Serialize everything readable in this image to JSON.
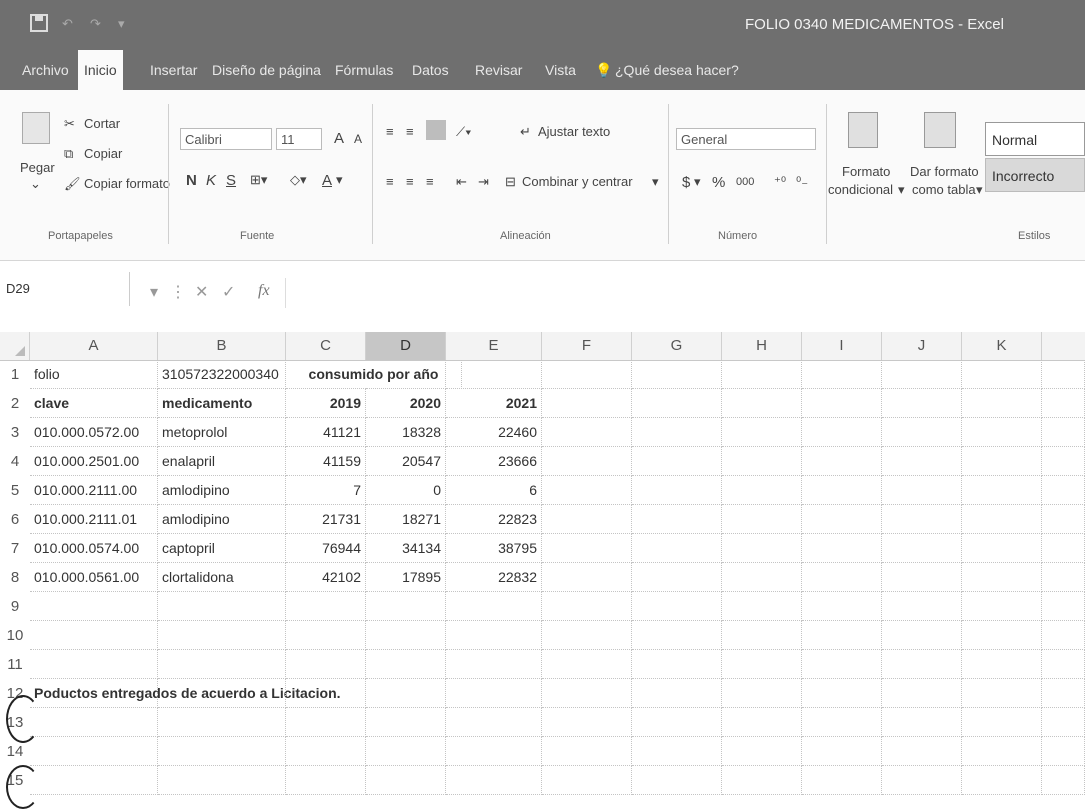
{
  "app": {
    "window_title": "FOLIO 0340 MEDICAMENTOS - Excel"
  },
  "tabs": [
    "Archivo",
    "Inicio",
    "Insertar",
    "Diseño de página",
    "Fórmulas",
    "Datos",
    "Revisar",
    "Vista"
  ],
  "tell_me": "¿Qué desea hacer?",
  "ribbon": {
    "clipboard": {
      "paste": "Pegar",
      "cut": "Cortar",
      "copy": "Copiar",
      "format_painter": "Copiar formato",
      "group": "Portapapeles"
    },
    "font": {
      "name": "Calibri",
      "size": "11",
      "bold": "N",
      "italic": "K",
      "underline": "S",
      "grow": "A",
      "shrink": "A",
      "group": "Fuente"
    },
    "alignment": {
      "wrap_text": "Ajustar texto",
      "merge_center": "Combinar y centrar",
      "group": "Alineación"
    },
    "number": {
      "format": "General",
      "currency": "$",
      "percent": "%",
      "thousands": "000",
      "group": "Número"
    },
    "styles": {
      "conditional_line1": "Formato",
      "conditional_line2": "condicional",
      "as_table_line1": "Dar formato",
      "as_table_line2": "como tabla",
      "normal": "Normal",
      "bad": "Incorrecto",
      "group": "Estilos"
    }
  },
  "formula_bar": {
    "name_box": "D29",
    "fx": "fx",
    "content": ""
  },
  "columns": [
    "A",
    "B",
    "C",
    "D",
    "E",
    "F",
    "G",
    "H",
    "I",
    "J",
    "K"
  ],
  "selected_column": "D",
  "rows": [
    {
      "n": "1",
      "cells": {
        "A": "folio",
        "B": "310572322000340",
        "C": "consumido por año"
      }
    },
    {
      "n": "2",
      "cells": {
        "A": "clave",
        "B": "medicamento",
        "C": "2019",
        "D": "2020",
        "E": "2021"
      }
    },
    {
      "n": "3",
      "cells": {
        "A": "010.000.0572.00",
        "B": "metoprolol",
        "C": "41121",
        "D": "18328",
        "E": "22460"
      }
    },
    {
      "n": "4",
      "cells": {
        "A": "010.000.2501.00",
        "B": "enalapril",
        "C": "41159",
        "D": "20547",
        "E": "23666"
      }
    },
    {
      "n": "5",
      "cells": {
        "A": "010.000.2111.00",
        "B": "amlodipino",
        "C": "7",
        "D": "0",
        "E": "6"
      }
    },
    {
      "n": "6",
      "cells": {
        "A": "010.000.2111.01",
        "B": "amlodipino",
        "C": "21731",
        "D": "18271",
        "E": "22823"
      }
    },
    {
      "n": "7",
      "cells": {
        "A": "010.000.0574.00",
        "B": "captopril",
        "C": "76944",
        "D": "34134",
        "E": "38795"
      }
    },
    {
      "n": "8",
      "cells": {
        "A": "010.000.0561.00",
        "B": "clortalidona",
        "C": "42102",
        "D": "17895",
        "E": "22832"
      }
    },
    {
      "n": "9",
      "cells": {}
    },
    {
      "n": "10",
      "cells": {}
    },
    {
      "n": "11",
      "cells": {}
    },
    {
      "n": "12",
      "cells": {
        "A": "Poductos entregados de acuerdo a Licitacion."
      }
    },
    {
      "n": "13",
      "cells": {}
    },
    {
      "n": "14",
      "cells": {}
    },
    {
      "n": "15",
      "cells": {}
    }
  ]
}
